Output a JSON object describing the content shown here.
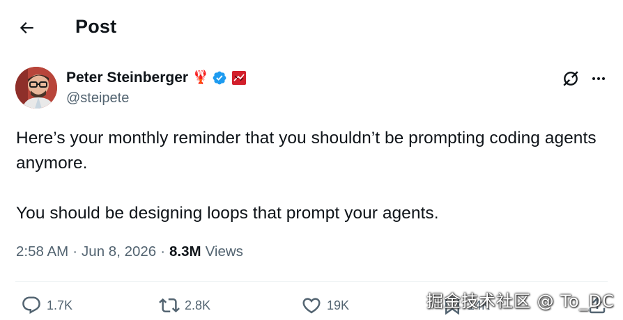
{
  "header": {
    "title": "Post"
  },
  "author": {
    "display_name": "Peter Steinberger",
    "handle": "@steipete",
    "name_emoji": "🦞",
    "verified": true,
    "affiliation_badge": "red-badge",
    "avatar": "avatar-photo"
  },
  "tweet": {
    "paragraphs": [
      "Here’s your monthly reminder that you shouldn’t be prompting coding agents anymore.",
      "You should be designing loops that prompt your agents."
    ]
  },
  "meta": {
    "time": "2:58 AM",
    "date": "Jun 8, 2026",
    "views_count": "8.3M",
    "views_label": "Views",
    "separator": "·"
  },
  "actions": {
    "reply_count": "1.7K",
    "repost_count": "2.8K",
    "like_count": "19K",
    "bookmark_count": "14K"
  },
  "watermark": "掘金技术社区 @ To_DC",
  "colors": {
    "text_primary": "#0f1419",
    "text_secondary": "#536471",
    "verified_blue": "#1d9bf0",
    "divider": "#eff3f4"
  }
}
